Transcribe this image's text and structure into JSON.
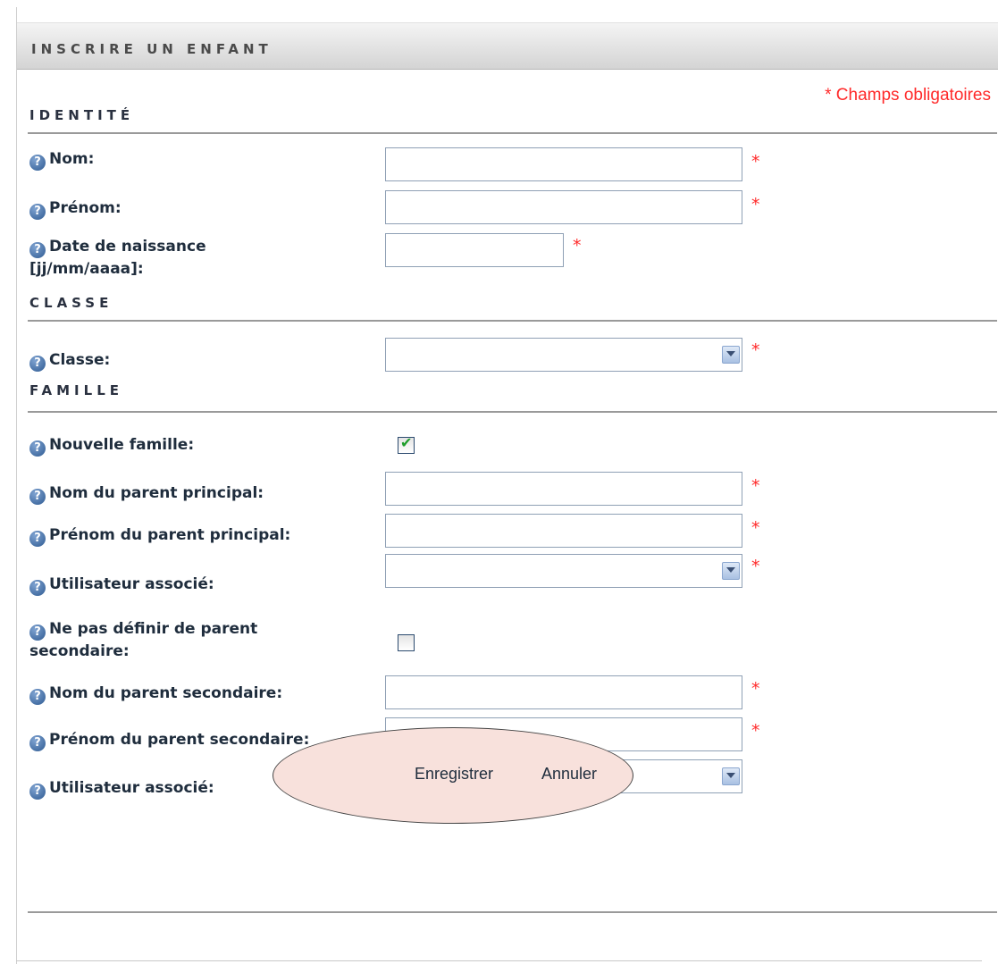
{
  "form": {
    "title": "INSCRIRE UN ENFANT",
    "required_note": "* Champs obligatoires",
    "required_marker": "*"
  },
  "sections": {
    "identite": "IDENTITÉ",
    "classe": "CLASSE",
    "famille": "FAMILLE"
  },
  "fields": {
    "nom": {
      "label": "Nom:",
      "value": ""
    },
    "prenom": {
      "label": "Prénom:",
      "value": ""
    },
    "date_naissance": {
      "label_line1": "Date de naissance",
      "label_line2": "[jj/mm/aaaa]:",
      "value": ""
    },
    "classe": {
      "label": "Classe:",
      "selected": ""
    },
    "nouvelle_famille": {
      "label": "Nouvelle famille:",
      "checked": true
    },
    "nom_parent_principal": {
      "label": "Nom du parent principal:",
      "value": ""
    },
    "prenom_parent_principal": {
      "label": "Prénom du parent principal:",
      "value": ""
    },
    "utilisateur_associe_1": {
      "label": "Utilisateur associé:",
      "selected": ""
    },
    "pas_parent_secondaire": {
      "label_line1": "Ne pas définir de parent",
      "label_line2": "secondaire:",
      "checked": false
    },
    "nom_parent_secondaire": {
      "label": "Nom du parent secondaire:",
      "value": ""
    },
    "prenom_parent_secondaire": {
      "label": "Prénom du parent secondaire:",
      "value": ""
    },
    "utilisateur_associe_2": {
      "label": "Utilisateur associé:",
      "selected": ""
    }
  },
  "actions": {
    "save": "Enregistrer",
    "cancel": "Annuler"
  },
  "icons": {
    "help": "help-question-icon",
    "dropdown": "chevron-down-icon",
    "check": "checkmark-icon"
  },
  "colors": {
    "required": "#ff2a2a",
    "highlight_oval": "#f8e1dc",
    "check": "#1e9d2b"
  }
}
